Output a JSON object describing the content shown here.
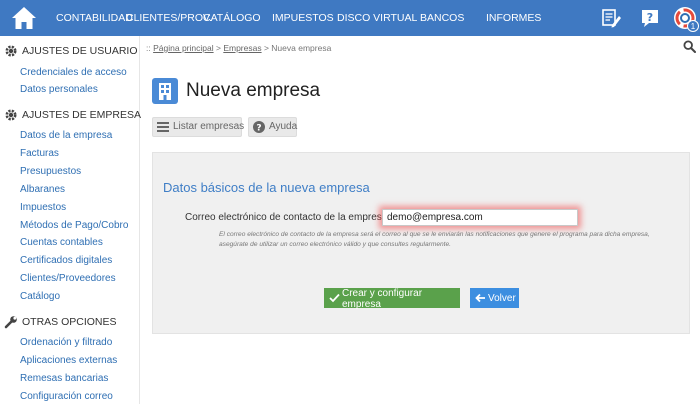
{
  "nav": {
    "items": [
      "CONTABILIDAD",
      "CLIENTES/PROV.",
      "CATÁLOGO",
      "IMPUESTOS",
      "DISCO VIRTUAL",
      "BANCOS",
      "INFORMES"
    ],
    "badge": "1"
  },
  "sidebar": {
    "sections": [
      {
        "title": "AJUSTES DE USUARIO",
        "items": [
          "Credenciales de acceso",
          "Datos personales"
        ]
      },
      {
        "title": "AJUSTES DE EMPRESA",
        "items": [
          "Datos de la empresa",
          "Facturas",
          "Presupuestos",
          "Albaranes",
          "Impuestos",
          "Métodos de Pago/Cobro",
          "Cuentas contables",
          "Certificados digitales",
          "Clientes/Proveedores",
          "Catálogo"
        ]
      },
      {
        "title": "OTRAS OPCIONES",
        "items": [
          "Ordenación y filtrado",
          "Aplicaciones externas",
          "Remesas bancarias",
          "Configuración correo"
        ]
      }
    ]
  },
  "breadcrumb": {
    "prefix": "::",
    "home": "Página principal",
    "sep": ">",
    "parent": "Empresas",
    "current": "Nueva empresa"
  },
  "page": {
    "title": "Nueva empresa"
  },
  "toolbar": {
    "list_label": "Listar empresas",
    "help_label": "Ayuda"
  },
  "form": {
    "section_title": "Datos básicos de la nueva empresa",
    "email_label": "Correo electrónico de contacto de la empresa:",
    "email_value": "demo@empresa.com",
    "email_help": "El correo electrónico de contacto de la empresa será el correo al que se le enviarán las notificaciones que genere el programa para dicha empresa, asegúrate de utilizar un correo electrónico válido y que consultes regularmente.",
    "create_label": "Crear y configurar empresa",
    "back_label": "Volver"
  },
  "colors": {
    "topbar": "#3f79c2",
    "link": "#2f6fb3",
    "create": "#5aa14b",
    "back": "#3c8ee0",
    "title": "#3f7ec6"
  }
}
